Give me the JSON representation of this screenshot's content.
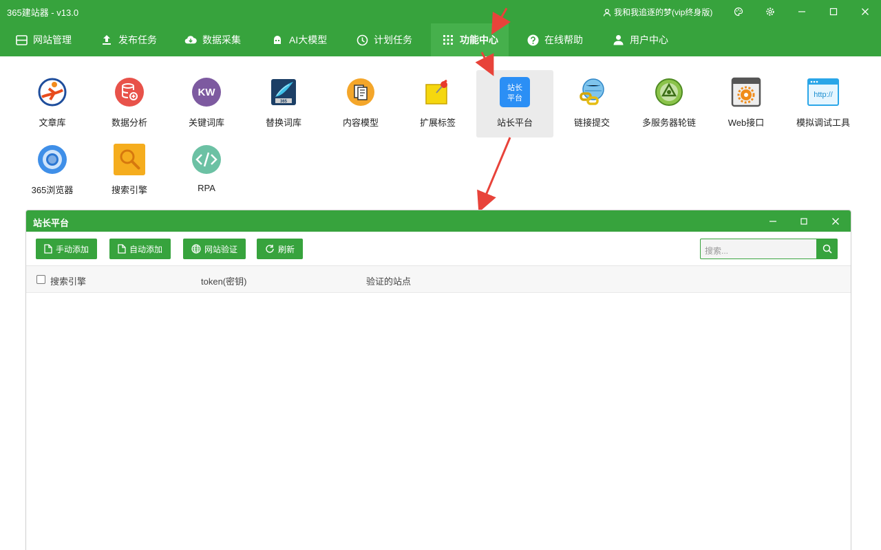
{
  "app": {
    "title": "365建站器 - v13.0",
    "user": "我和我追逐的梦(vip终身版)"
  },
  "nav": [
    {
      "label": "网站管理",
      "icon": "window-icon"
    },
    {
      "label": "发布任务",
      "icon": "upload-icon"
    },
    {
      "label": "数据采集",
      "icon": "cloud-download-icon"
    },
    {
      "label": "AI大模型",
      "icon": "robot-icon"
    },
    {
      "label": "计划任务",
      "icon": "clock-icon"
    },
    {
      "label": "功能中心",
      "icon": "grid-icon",
      "active": true
    },
    {
      "label": "在线帮助",
      "icon": "help-icon"
    },
    {
      "label": "用户中心",
      "icon": "user-icon"
    }
  ],
  "features": [
    {
      "label": "文章库",
      "icon": "article-library-icon"
    },
    {
      "label": "数据分析",
      "icon": "database-icon"
    },
    {
      "label": "关键词库",
      "icon": "keyword-icon",
      "text": "KW"
    },
    {
      "label": "替换词库",
      "icon": "replace-words-icon",
      "text": "365"
    },
    {
      "label": "内容模型",
      "icon": "content-model-icon"
    },
    {
      "label": "扩展标签",
      "icon": "sticky-note-icon"
    },
    {
      "label": "站长平台",
      "icon": "webmaster-platform-icon",
      "text": "站长平台",
      "selected": true
    },
    {
      "label": "链接提交",
      "icon": "link-submit-icon"
    },
    {
      "label": "多服务器轮链",
      "icon": "multi-server-icon"
    },
    {
      "label": "Web接口",
      "icon": "web-api-icon"
    },
    {
      "label": "模拟调试工具",
      "icon": "http-debug-icon",
      "text": "http://"
    },
    {
      "label": "365浏览器",
      "icon": "browser-icon"
    },
    {
      "label": "搜索引擎",
      "icon": "search-engine-icon"
    },
    {
      "label": "RPA",
      "icon": "code-icon"
    }
  ],
  "subwindow": {
    "title": "站长平台",
    "buttons": [
      {
        "label": "手动添加",
        "icon": "file-icon"
      },
      {
        "label": "自动添加",
        "icon": "file-icon"
      },
      {
        "label": "网站验证",
        "icon": "globe-icon"
      },
      {
        "label": "刷新",
        "icon": "refresh-icon"
      }
    ],
    "search_placeholder": "搜索...",
    "columns": [
      "搜索引擎",
      "token(密钥)",
      "验证的站点"
    ]
  },
  "colors": {
    "brand": "#37a33d",
    "annotation": "#e8433a"
  }
}
